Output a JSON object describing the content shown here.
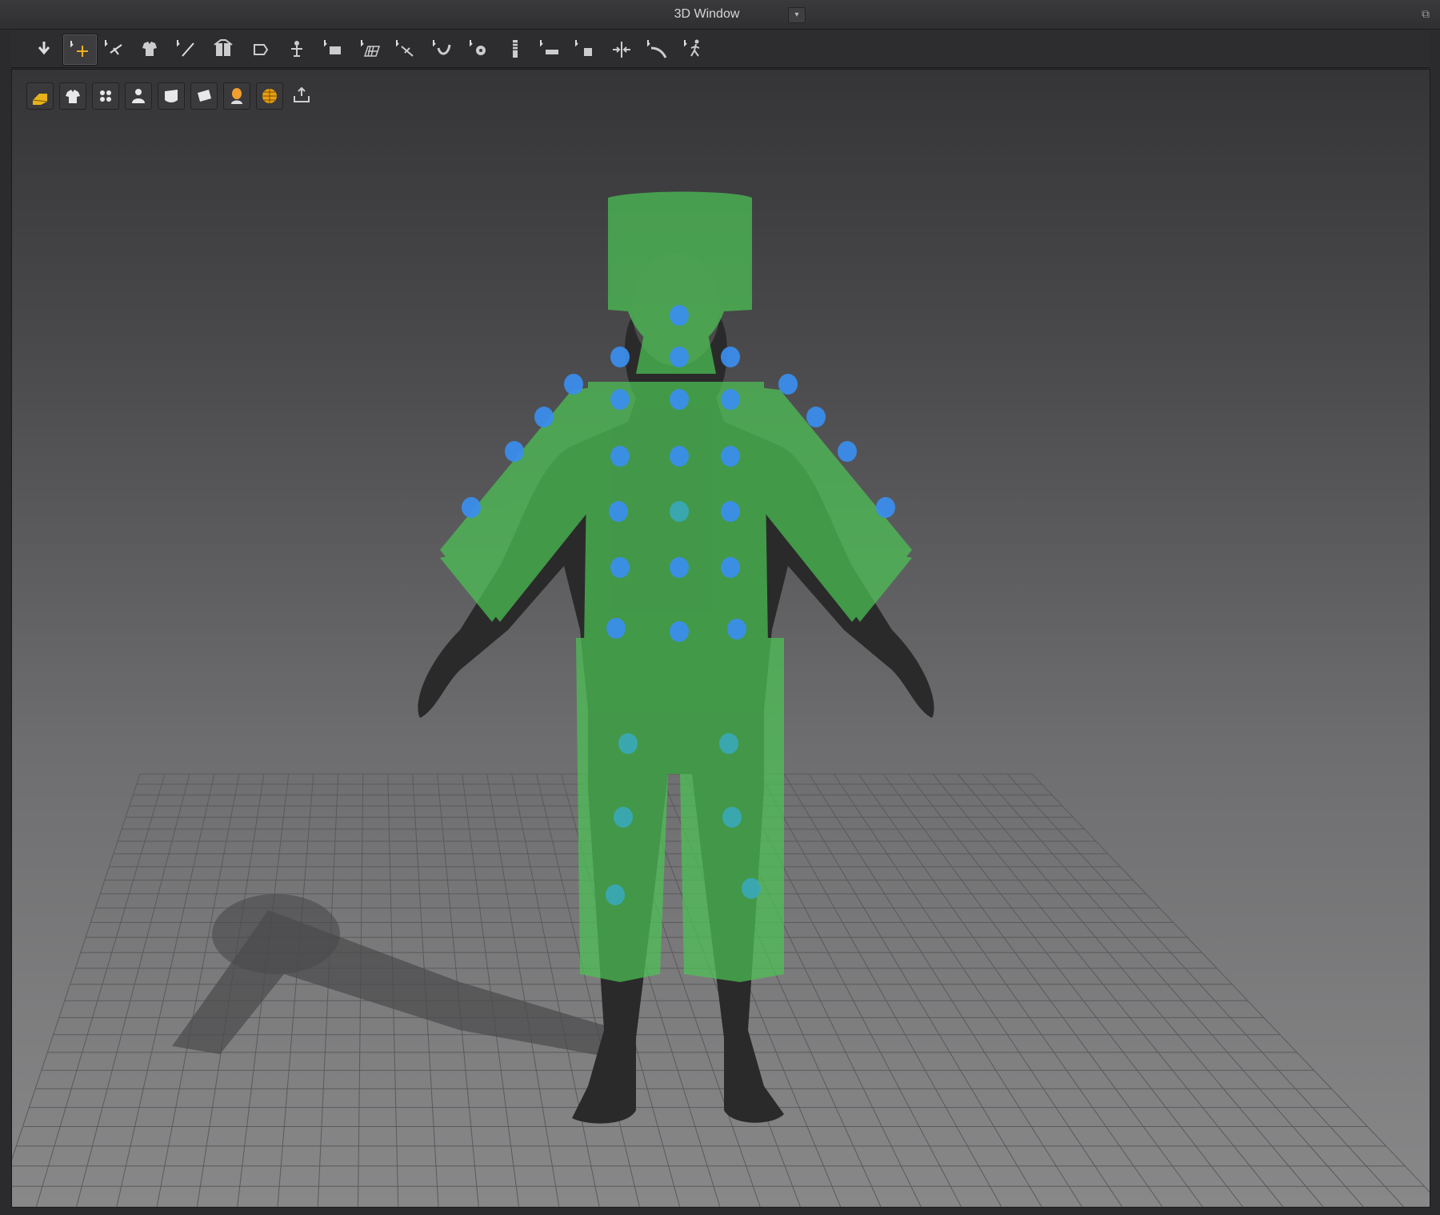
{
  "window": {
    "title": "3D Window",
    "dropdown_glyph": "▾",
    "float_glyph": "⧉"
  },
  "toolbar": {
    "tools": [
      {
        "name": "simulate-icon",
        "active": false
      },
      {
        "name": "select-move-icon",
        "active": true
      },
      {
        "name": "select-mesh-icon",
        "active": false
      },
      {
        "name": "garment-icon",
        "active": false
      },
      {
        "name": "pin-icon",
        "active": false
      },
      {
        "name": "fold-arrangement-icon",
        "active": false
      },
      {
        "name": "fold-icon",
        "active": false
      },
      {
        "name": "arrangement-icon",
        "active": false
      },
      {
        "name": "transform-pattern-icon",
        "active": false
      },
      {
        "name": "mesh-grid-icon",
        "active": false
      },
      {
        "name": "edit-curvature-icon",
        "active": false
      },
      {
        "name": "tuck-icon",
        "active": false
      },
      {
        "name": "button-icon",
        "active": false
      },
      {
        "name": "zipper-icon",
        "active": false
      },
      {
        "name": "tape-icon",
        "active": false
      },
      {
        "name": "measure-icon",
        "active": false
      },
      {
        "name": "split-icon",
        "active": false
      },
      {
        "name": "line-icon",
        "active": false
      },
      {
        "name": "walk-icon",
        "active": false
      }
    ]
  },
  "view_tools": [
    {
      "name": "avatar-display-icon",
      "color": "#e8b21a"
    },
    {
      "name": "garment-display-icon",
      "color": "#e8e8e8"
    },
    {
      "name": "arrangement-points-icon",
      "color": "#e8e8e8"
    },
    {
      "name": "avatar-body-icon",
      "color": "#e8e8e8"
    },
    {
      "name": "texture-surface-icon",
      "color": "#e8e8e8"
    },
    {
      "name": "pattern-surface-icon",
      "color": "#e8e8e8"
    },
    {
      "name": "avatar-skin-icon",
      "color": "#f0a030"
    },
    {
      "name": "environment-icon",
      "color": "#e8a010"
    },
    {
      "name": "export-icon",
      "color": "#cfcfcf"
    }
  ],
  "scene": {
    "garment_color": "#4cc454",
    "point_color": "#3a8ef0",
    "point_color_alt": "#3aa8b8",
    "avatar_color": "#2a2a2a",
    "grid_color": "#5a5a5c"
  }
}
